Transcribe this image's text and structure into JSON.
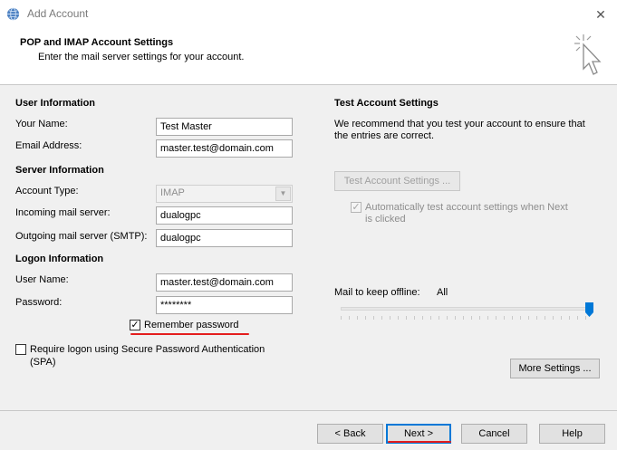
{
  "window": {
    "title": "Add Account",
    "close_icon": "✕"
  },
  "header": {
    "title": "POP and IMAP Account Settings",
    "subtitle": "Enter the mail server settings for your account."
  },
  "user_info": {
    "heading": "User Information",
    "name_label": "Your Name:",
    "name_value": "Test Master",
    "email_label": "Email Address:",
    "email_value": "master.test@domain.com"
  },
  "server_info": {
    "heading": "Server Information",
    "account_type_label": "Account Type:",
    "account_type_value": "IMAP",
    "incoming_label": "Incoming mail server:",
    "incoming_value": "dualogpc",
    "outgoing_label": "Outgoing mail server (SMTP):",
    "outgoing_value": "dualogpc"
  },
  "logon_info": {
    "heading": "Logon Information",
    "username_label": "User Name:",
    "username_value": "master.test@domain.com",
    "password_label": "Password:",
    "password_value": "********",
    "remember_label": "Remember password",
    "remember_checked": true,
    "spa_label_line1": "Require logon using Secure Password Authentication",
    "spa_label_line2": "(SPA)",
    "spa_checked": false
  },
  "test_settings": {
    "heading": "Test Account Settings",
    "desc_line1": "We recommend that you test your account to ensure that",
    "desc_line2": "the entries are correct.",
    "button_label": "Test Account Settings ...",
    "auto_test_line1": "Automatically test account settings when Next",
    "auto_test_line2": "is clicked",
    "auto_test_checked": true
  },
  "offline": {
    "label": "Mail to keep offline:",
    "value": "All",
    "slider_level": 1.0
  },
  "more_settings_label": "More Settings ...",
  "footer": {
    "back_label": "< Back",
    "next_label": "Next >",
    "cancel_label": "Cancel",
    "help_label": "Help"
  },
  "colors": {
    "accent": "#0078d7",
    "annotation_red": "#e41d1d"
  },
  "icons": [
    "globe-icon",
    "close-icon",
    "wizard-cursor-icon",
    "checkmark-icon",
    "dropdown-arrow-icon",
    "slider-thumb-icon"
  ]
}
